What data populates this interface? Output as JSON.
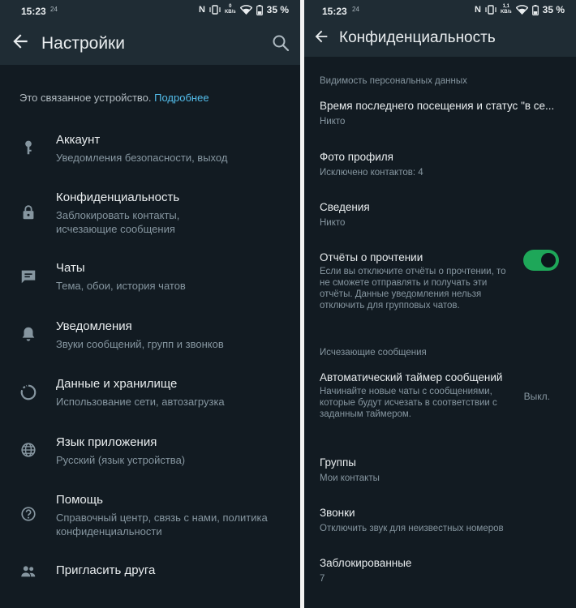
{
  "status": {
    "time": "15:23",
    "left_indicator": "24",
    "nfc": "N",
    "speed_left_top": "0",
    "speed_right_top": "1,1",
    "speed_unit": "KB/s",
    "battery_pct": "35 %"
  },
  "settings": {
    "title": "Настройки",
    "linked_text": "Это связанное устройство.",
    "linked_link": "Подробнее",
    "items": [
      {
        "title": "Аккаунт",
        "subtitle": "Уведомления безопасности, выход",
        "icon": "key-icon"
      },
      {
        "title": "Конфиденциальность",
        "subtitle": "Заблокировать контакты, исчезающие сообщения",
        "icon": "lock-icon"
      },
      {
        "title": "Чаты",
        "subtitle": "Тема, обои, история чатов",
        "icon": "chat-icon"
      },
      {
        "title": "Уведомления",
        "subtitle": "Звуки сообщений, групп и звонков",
        "icon": "bell-icon"
      },
      {
        "title": "Данные и хранилище",
        "subtitle": "Использование сети, автозагрузка",
        "icon": "storage-icon"
      },
      {
        "title": "Язык приложения",
        "subtitle": "Русский (язык устройства)",
        "icon": "globe-icon"
      },
      {
        "title": "Помощь",
        "subtitle": "Справочный центр, связь с нами, политика конфиденциальности",
        "icon": "help-icon"
      },
      {
        "title": "Пригласить друга",
        "subtitle": "",
        "icon": "people-icon"
      }
    ]
  },
  "privacy": {
    "title": "Конфиденциальность",
    "section_visibility": "Видимость персональных данных",
    "last_seen_title": "Время последнего посещения и статус \"в се...",
    "last_seen_value": "Никто",
    "photo_title": "Фото профиля",
    "photo_value": "Исключено контактов: 4",
    "about_title": "Сведения",
    "about_value": "Никто",
    "receipts_title": "Отчёты о прочтении",
    "receipts_desc": "Если вы отключите отчёты о прочтении, то не сможете отправлять и получать эти отчёты. Данные уведомления нельзя отключить для групповых чатов.",
    "receipts_enabled": true,
    "section_disappearing": "Исчезающие сообщения",
    "timer_title": "Автоматический таймер сообщений",
    "timer_desc": "Начинайте новые чаты с сообщениями, которые будут исчезать в соответствии с заданным таймером.",
    "timer_value": "Выкл.",
    "groups_title": "Группы",
    "groups_value": "Мои контакты",
    "calls_title": "Звонки",
    "calls_value": "Отключить звук для неизвестных номеров",
    "blocked_title": "Заблокированные",
    "blocked_value": "7"
  },
  "colors": {
    "background": "#121b22",
    "appbar": "#1f2c34",
    "accent": "#21c063",
    "link": "#53bdeb",
    "secondary_text": "#8696a0"
  }
}
